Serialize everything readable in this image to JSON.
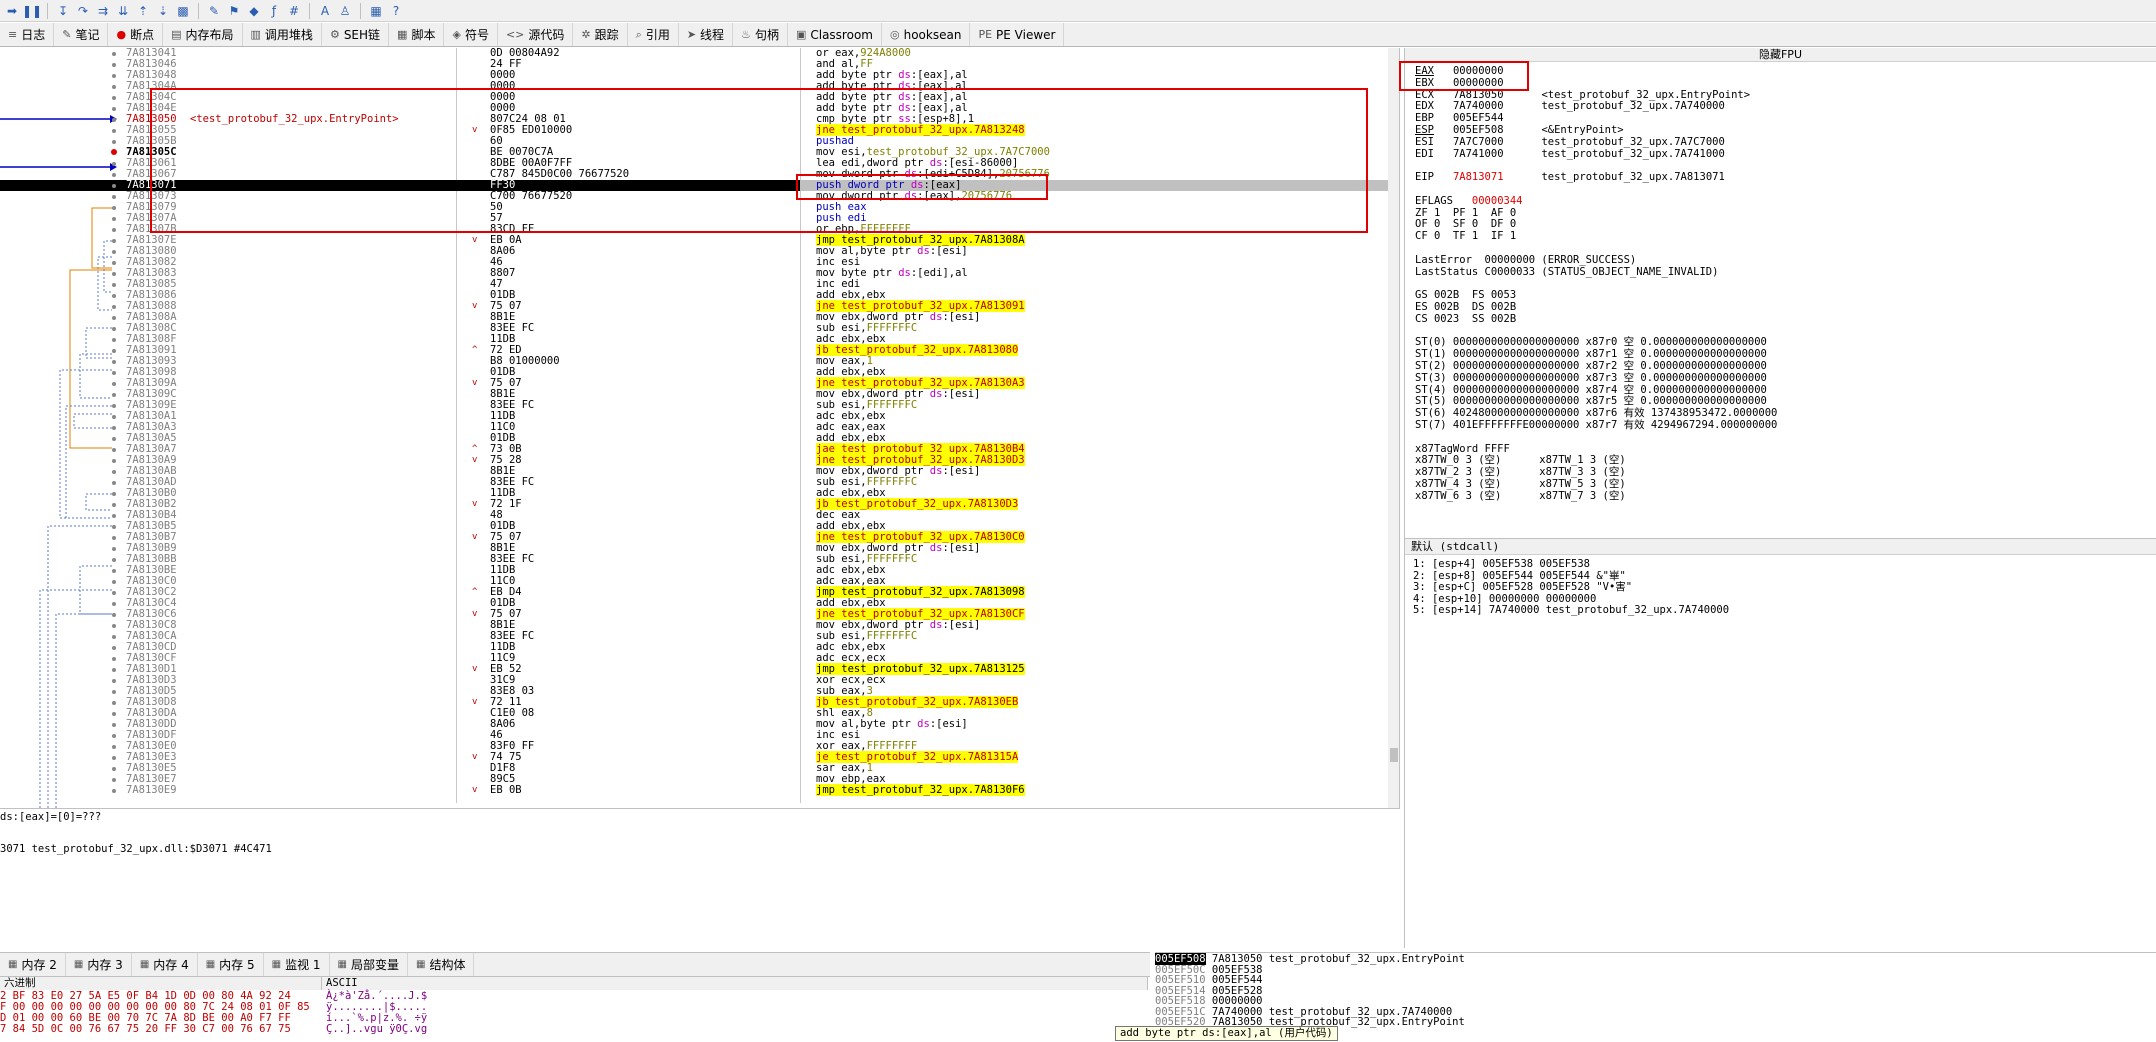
{
  "tabs": [
    {
      "icon": "log-icon",
      "glyph": "≡",
      "label": "日志"
    },
    {
      "icon": "notes-icon",
      "glyph": "✎",
      "label": "笔记"
    },
    {
      "icon": "breakpoint-icon",
      "glyph": "●",
      "label": "断点"
    },
    {
      "icon": "memory-map-icon",
      "glyph": "▤",
      "label": "内存布局"
    },
    {
      "icon": "callstack-icon",
      "glyph": "▥",
      "label": "调用堆栈"
    },
    {
      "icon": "seh-icon",
      "glyph": "⚙",
      "label": "SEH链"
    },
    {
      "icon": "script-icon",
      "glyph": "▦",
      "label": "脚本"
    },
    {
      "icon": "symbols-icon",
      "glyph": "◈",
      "label": "符号"
    },
    {
      "icon": "source-icon",
      "glyph": "<>",
      "label": "源代码"
    },
    {
      "icon": "trace-icon",
      "glyph": "✲",
      "label": "跟踪"
    },
    {
      "icon": "references-icon",
      "glyph": "⌕",
      "label": "引用"
    },
    {
      "icon": "threads-icon",
      "glyph": "➤",
      "label": "线程"
    },
    {
      "icon": "handles-icon",
      "glyph": "♨",
      "label": "句柄"
    },
    {
      "icon": "classroom-icon",
      "glyph": "▣",
      "label": "Classroom"
    },
    {
      "icon": "hooksean-icon",
      "glyph": "◎",
      "label": "hooksean"
    },
    {
      "icon": "pe-viewer-icon",
      "glyph": "PE",
      "label": "PE Viewer"
    }
  ],
  "disasm_rows": [
    {
      "addr": "7A813041",
      "bytes": "0D 00804A92",
      "jm": "",
      "ins": [
        [
          "op",
          "or eax,"
        ],
        [
          "num",
          "924A8000"
        ]
      ]
    },
    {
      "addr": "7A813046",
      "bytes": "24 FF",
      "jm": "",
      "ins": [
        [
          "op",
          "and al,"
        ],
        [
          "num",
          "FF"
        ]
      ]
    },
    {
      "addr": "7A813048",
      "bytes": "0000",
      "jm": "",
      "ins": [
        [
          "op",
          "add byte ptr "
        ],
        [
          "seg",
          "ds"
        ],
        [
          "op",
          ":[eax],al"
        ]
      ]
    },
    {
      "addr": "7A81304A",
      "bytes": "0000",
      "jm": "",
      "ins": [
        [
          "op",
          "add byte ptr "
        ],
        [
          "seg",
          "ds"
        ],
        [
          "op",
          ":[eax],al"
        ]
      ]
    },
    {
      "addr": "7A81304C",
      "bytes": "0000",
      "jm": "",
      "ins": [
        [
          "op",
          "add byte ptr "
        ],
        [
          "seg",
          "ds"
        ],
        [
          "op",
          ":[eax],al"
        ]
      ]
    },
    {
      "addr": "7A81304E",
      "bytes": "0000",
      "jm": "",
      "ins": [
        [
          "op",
          "add byte ptr "
        ],
        [
          "seg",
          "ds"
        ],
        [
          "op",
          ":[eax],al"
        ]
      ]
    },
    {
      "addr": "7A813050",
      "bytes": "807C24 08 01",
      "jm": "",
      "ep": "ep",
      "label": "<test_protobuf_32_upx.EntryPoint>",
      "ins": [
        [
          "op",
          "cmp byte ptr "
        ],
        [
          "seg",
          "ss"
        ],
        [
          "op",
          ":[esp+8],1"
        ]
      ]
    },
    {
      "addr": "7A813055",
      "bytes": "0F85 ED010000",
      "jm": "v",
      "ins": [
        [
          "jc",
          "jne test_protobuf_32_upx.7A813248"
        ]
      ]
    },
    {
      "addr": "7A81305B",
      "bytes": "60",
      "jm": "",
      "ins": [
        [
          "push",
          "pushad"
        ]
      ]
    },
    {
      "addr": "7A81305C",
      "bytes": "BE 0070C7A",
      "jm": "",
      "ep": "ep2",
      "ins": [
        [
          "op",
          "mov esi,"
        ],
        [
          "num",
          "test_protobuf_32_upx.7A7C7000"
        ]
      ]
    },
    {
      "addr": "7A813061",
      "bytes": "8DBE 00A0F7FF",
      "jm": "",
      "ins": [
        [
          "op",
          "lea edi,dword ptr "
        ],
        [
          "seg",
          "ds"
        ],
        [
          "op",
          ":[esi-86000]"
        ]
      ]
    },
    {
      "addr": "7A813067",
      "bytes": "C787 845D0C00 76677520",
      "jm": "",
      "ins": [
        [
          "op",
          "mov dword ptr "
        ],
        [
          "seg",
          "ds"
        ],
        [
          "op",
          ":[edi+C5D84],"
        ],
        [
          "num",
          "20756776"
        ]
      ]
    },
    {
      "addr": "7A813071",
      "bytes": "FF30",
      "jm": "",
      "sel": true,
      "ins": [
        [
          "push",
          "push dword ptr "
        ],
        [
          "seg",
          "ds"
        ],
        [
          "op",
          ":[eax]"
        ]
      ]
    },
    {
      "addr": "7A813073",
      "bytes": "C700 76677520",
      "jm": "",
      "ins": [
        [
          "op",
          "mov dword ptr "
        ],
        [
          "seg",
          "ds"
        ],
        [
          "op",
          ":[eax],"
        ],
        [
          "num",
          "20756776"
        ]
      ]
    },
    {
      "addr": "7A813079",
      "bytes": "50",
      "jm": "",
      "ins": [
        [
          "push",
          "push eax"
        ]
      ]
    },
    {
      "addr": "7A81307A",
      "bytes": "57",
      "jm": "",
      "ins": [
        [
          "push",
          "push edi"
        ]
      ]
    },
    {
      "addr": "7A81307B",
      "bytes": "83CD FF",
      "jm": "",
      "ins": [
        [
          "op",
          "or ebp,"
        ],
        [
          "num",
          "FFFFFFFF"
        ]
      ]
    },
    {
      "addr": "7A81307E",
      "bytes": "EB 0A",
      "jm": "v",
      "ins": [
        [
          "jmp",
          "jmp test_protobuf_32_upx.7A81308A"
        ]
      ]
    },
    {
      "addr": "7A813080",
      "bytes": "8A06",
      "jm": "",
      "ins": [
        [
          "op",
          "mov al,byte ptr "
        ],
        [
          "seg",
          "ds"
        ],
        [
          "op",
          ":[esi]"
        ]
      ]
    },
    {
      "addr": "7A813082",
      "bytes": "46",
      "jm": "",
      "ins": [
        [
          "op",
          "inc esi"
        ]
      ]
    },
    {
      "addr": "7A813083",
      "bytes": "8807",
      "jm": "",
      "ins": [
        [
          "op",
          "mov byte ptr "
        ],
        [
          "seg",
          "ds"
        ],
        [
          "op",
          ":[edi],al"
        ]
      ]
    },
    {
      "addr": "7A813085",
      "bytes": "47",
      "jm": "",
      "ins": [
        [
          "op",
          "inc edi"
        ]
      ]
    },
    {
      "addr": "7A813086",
      "bytes": "01DB",
      "jm": "",
      "ins": [
        [
          "op",
          "add ebx,ebx"
        ]
      ]
    },
    {
      "addr": "7A813088",
      "bytes": "75 07",
      "jm": "v",
      "ins": [
        [
          "jc",
          "jne test_protobuf_32_upx.7A813091"
        ]
      ]
    },
    {
      "addr": "7A81308A",
      "bytes": "8B1E",
      "jm": "",
      "ins": [
        [
          "op",
          "mov ebx,dword ptr "
        ],
        [
          "seg",
          "ds"
        ],
        [
          "op",
          ":[esi]"
        ]
      ]
    },
    {
      "addr": "7A81308C",
      "bytes": "83EE FC",
      "jm": "",
      "ins": [
        [
          "op",
          "sub esi,"
        ],
        [
          "num",
          "FFFFFFFC"
        ]
      ]
    },
    {
      "addr": "7A81308F",
      "bytes": "11DB",
      "jm": "",
      "ins": [
        [
          "op",
          "adc ebx,ebx"
        ]
      ]
    },
    {
      "addr": "7A813091",
      "bytes": "72 ED",
      "jm": "^",
      "ins": [
        [
          "jc",
          "jb test_protobuf_32_upx.7A813080"
        ]
      ]
    },
    {
      "addr": "7A813093",
      "bytes": "B8 01000000",
      "jm": "",
      "ins": [
        [
          "op",
          "mov eax,"
        ],
        [
          "num",
          "1"
        ]
      ]
    },
    {
      "addr": "7A813098",
      "bytes": "01DB",
      "jm": "",
      "ins": [
        [
          "op",
          "add ebx,ebx"
        ]
      ]
    },
    {
      "addr": "7A81309A",
      "bytes": "75 07",
      "jm": "v",
      "ins": [
        [
          "jc",
          "jne test_protobuf_32_upx.7A8130A3"
        ]
      ]
    },
    {
      "addr": "7A81309C",
      "bytes": "8B1E",
      "jm": "",
      "ins": [
        [
          "op",
          "mov ebx,dword ptr "
        ],
        [
          "seg",
          "ds"
        ],
        [
          "op",
          ":[esi]"
        ]
      ]
    },
    {
      "addr": "7A81309E",
      "bytes": "83EE FC",
      "jm": "",
      "ins": [
        [
          "op",
          "sub esi,"
        ],
        [
          "num",
          "FFFFFFFC"
        ]
      ]
    },
    {
      "addr": "7A8130A1",
      "bytes": "11DB",
      "jm": "",
      "ins": [
        [
          "op",
          "adc ebx,ebx"
        ]
      ]
    },
    {
      "addr": "7A8130A3",
      "bytes": "11C0",
      "jm": "",
      "ins": [
        [
          "op",
          "adc eax,eax"
        ]
      ]
    },
    {
      "addr": "7A8130A5",
      "bytes": "01DB",
      "jm": "",
      "ins": [
        [
          "op",
          "add ebx,ebx"
        ]
      ]
    },
    {
      "addr": "7A8130A7",
      "bytes": "73 0B",
      "jm": "^",
      "ins": [
        [
          "jc",
          "jae test_protobuf_32_upx.7A8130B4"
        ]
      ]
    },
    {
      "addr": "7A8130A9",
      "bytes": "75 28",
      "jm": "v",
      "ins": [
        [
          "jc",
          "jne test_protobuf_32_upx.7A8130D3"
        ]
      ]
    },
    {
      "addr": "7A8130AB",
      "bytes": "8B1E",
      "jm": "",
      "ins": [
        [
          "op",
          "mov ebx,dword ptr "
        ],
        [
          "seg",
          "ds"
        ],
        [
          "op",
          ":[esi]"
        ]
      ]
    },
    {
      "addr": "7A8130AD",
      "bytes": "83EE FC",
      "jm": "",
      "ins": [
        [
          "op",
          "sub esi,"
        ],
        [
          "num",
          "FFFFFFFC"
        ]
      ]
    },
    {
      "addr": "7A8130B0",
      "bytes": "11DB",
      "jm": "",
      "ins": [
        [
          "op",
          "adc ebx,ebx"
        ]
      ]
    },
    {
      "addr": "7A8130B2",
      "bytes": "72 1F",
      "jm": "v",
      "ins": [
        [
          "jc",
          "jb test_protobuf_32_upx.7A8130D3"
        ]
      ]
    },
    {
      "addr": "7A8130B4",
      "bytes": "48",
      "jm": "",
      "ins": [
        [
          "op",
          "dec eax"
        ]
      ]
    },
    {
      "addr": "7A8130B5",
      "bytes": "01DB",
      "jm": "",
      "ins": [
        [
          "op",
          "add ebx,ebx"
        ]
      ]
    },
    {
      "addr": "7A8130B7",
      "bytes": "75 07",
      "jm": "v",
      "ins": [
        [
          "jc",
          "jne test_protobuf_32_upx.7A8130C0"
        ]
      ]
    },
    {
      "addr": "7A8130B9",
      "bytes": "8B1E",
      "jm": "",
      "ins": [
        [
          "op",
          "mov ebx,dword ptr "
        ],
        [
          "seg",
          "ds"
        ],
        [
          "op",
          ":[esi]"
        ]
      ]
    },
    {
      "addr": "7A8130BB",
      "bytes": "83EE FC",
      "jm": "",
      "ins": [
        [
          "op",
          "sub esi,"
        ],
        [
          "num",
          "FFFFFFFC"
        ]
      ]
    },
    {
      "addr": "7A8130BE",
      "bytes": "11DB",
      "jm": "",
      "ins": [
        [
          "op",
          "adc ebx,ebx"
        ]
      ]
    },
    {
      "addr": "7A8130C0",
      "bytes": "11C0",
      "jm": "",
      "ins": [
        [
          "op",
          "adc eax,eax"
        ]
      ]
    },
    {
      "addr": "7A8130C2",
      "bytes": "EB D4",
      "jm": "^",
      "ins": [
        [
          "jmp",
          "jmp test_protobuf_32_upx.7A813098"
        ]
      ]
    },
    {
      "addr": "7A8130C4",
      "bytes": "01DB",
      "jm": "",
      "ins": [
        [
          "op",
          "add ebx,ebx"
        ]
      ]
    },
    {
      "addr": "7A8130C6",
      "bytes": "75 07",
      "jm": "v",
      "ins": [
        [
          "jc",
          "jne test_protobuf_32_upx.7A8130CF"
        ]
      ]
    },
    {
      "addr": "7A8130C8",
      "bytes": "8B1E",
      "jm": "",
      "ins": [
        [
          "op",
          "mov ebx,dword ptr "
        ],
        [
          "seg",
          "ds"
        ],
        [
          "op",
          ":[esi]"
        ]
      ]
    },
    {
      "addr": "7A8130CA",
      "bytes": "83EE FC",
      "jm": "",
      "ins": [
        [
          "op",
          "sub esi,"
        ],
        [
          "num",
          "FFFFFFFC"
        ]
      ]
    },
    {
      "addr": "7A8130CD",
      "bytes": "11DB",
      "jm": "",
      "ins": [
        [
          "op",
          "adc ebx,ebx"
        ]
      ]
    },
    {
      "addr": "7A8130CF",
      "bytes": "11C9",
      "jm": "",
      "ins": [
        [
          "op",
          "adc ecx,ecx"
        ]
      ]
    },
    {
      "addr": "7A8130D1",
      "bytes": "EB 52",
      "jm": "v",
      "ins": [
        [
          "jmp",
          "jmp test_protobuf_32_upx.7A813125"
        ]
      ]
    },
    {
      "addr": "7A8130D3",
      "bytes": "31C9",
      "jm": "",
      "ins": [
        [
          "op",
          "xor ecx,ecx"
        ]
      ]
    },
    {
      "addr": "7A8130D5",
      "bytes": "83E8 03",
      "jm": "",
      "ins": [
        [
          "op",
          "sub eax,"
        ],
        [
          "num",
          "3"
        ]
      ]
    },
    {
      "addr": "7A8130D8",
      "bytes": "72 11",
      "jm": "v",
      "ins": [
        [
          "jc",
          "jb test_protobuf_32_upx.7A8130EB"
        ]
      ]
    },
    {
      "addr": "7A8130DA",
      "bytes": "C1E0 08",
      "jm": "",
      "ins": [
        [
          "op",
          "shl eax,"
        ],
        [
          "num",
          "8"
        ]
      ]
    },
    {
      "addr": "7A8130DD",
      "bytes": "8A06",
      "jm": "",
      "ins": [
        [
          "op",
          "mov al,byte ptr "
        ],
        [
          "seg",
          "ds"
        ],
        [
          "op",
          ":[esi]"
        ]
      ]
    },
    {
      "addr": "7A8130DF",
      "bytes": "46",
      "jm": "",
      "ins": [
        [
          "op",
          "inc esi"
        ]
      ]
    },
    {
      "addr": "7A8130E0",
      "bytes": "83F0 FF",
      "jm": "",
      "ins": [
        [
          "op",
          "xor eax,"
        ],
        [
          "num",
          "FFFFFFFF"
        ]
      ]
    },
    {
      "addr": "7A8130E3",
      "bytes": "74 75",
      "jm": "v",
      "ins": [
        [
          "jc",
          "je test_protobuf_32_upx.7A81315A"
        ]
      ]
    },
    {
      "addr": "7A8130E5",
      "bytes": "D1F8",
      "jm": "",
      "ins": [
        [
          "op",
          "sar eax,"
        ],
        [
          "num",
          "1"
        ]
      ]
    },
    {
      "addr": "7A8130E7",
      "bytes": "89C5",
      "jm": "",
      "ins": [
        [
          "op",
          "mov ebp,eax"
        ]
      ]
    },
    {
      "addr": "7A8130E9",
      "bytes": "EB 0B",
      "jm": "v",
      "ins": [
        [
          "jmp",
          "jmp test_protobuf_32_upx.7A8130F6"
        ]
      ]
    }
  ],
  "info": {
    "line1": "ds:[eax]=[0]=???",
    "line2": "3071 test_protobuf_32_upx.dll:$D3071 #4C471"
  },
  "registers": {
    "header": "隐藏FPU",
    "lines": [
      [
        "EAX",
        "00000000",
        ""
      ],
      [
        "EBX",
        "00000000",
        ""
      ],
      [
        "ECX",
        "7A813050",
        "<test_protobuf_32_upx.EntryPoint>"
      ],
      [
        "EDX",
        "7A740000",
        "test_protobuf_32_upx.7A740000"
      ],
      [
        "EBP",
        "005EF544",
        ""
      ],
      [
        "ESP",
        "005EF508",
        "<&EntryPoint>"
      ],
      [
        "ESI",
        "7A7C7000",
        "test_protobuf_32_upx.7A7C7000"
      ],
      [
        "EDI",
        "7A741000",
        "test_protobuf_32_upx.7A741000"
      ]
    ],
    "eip": [
      "EIP",
      "7A813071",
      "test_protobuf_32_upx.7A813071"
    ],
    "eflags": [
      "EFLAGS",
      "00000344"
    ],
    "flags": [
      "ZF 1  PF 1  AF 0",
      "OF 0  SF 0  DF 0",
      "CF 0  TF 1  IF 1"
    ],
    "lasterror": "LastError  00000000 (ERROR_SUCCESS)",
    "laststatus": "LastStatus C0000033 (STATUS_OBJECT_NAME_INVALID)",
    "segs": [
      "GS 002B  FS 0053",
      "ES 002B  DS 002B",
      "CS 0023  SS 002B"
    ],
    "fpu": [
      "ST(0) 00000000000000000000 x87r0 空 0.000000000000000000",
      "ST(1) 00000000000000000000 x87r1 空 0.000000000000000000",
      "ST(2) 00000000000000000000 x87r2 空 0.000000000000000000",
      "ST(3) 00000000000000000000 x87r3 空 0.000000000000000000",
      "ST(4) 00000000000000000000 x87r4 空 0.000000000000000000",
      "ST(5) 00000000000000000000 x87r5 空 0.000000000000000000",
      "ST(6) 40248000000000000000 x87r6 有效 137438953472.0000000",
      "ST(7) 401EFFFFFFFE00000000 x87r7 有效 4294967294.000000000"
    ],
    "tagword": "x87TagWord FFFF",
    "tags": [
      "x87TW_0 3 (空)      x87TW_1 3 (空)",
      "x87TW_2 3 (空)      x87TW_3 3 (空)",
      "x87TW_4 3 (空)      x87TW_5 3 (空)",
      "x87TW_6 3 (空)      x87TW_7 3 (空)"
    ]
  },
  "callstack": {
    "header": "默认 (stdcall)",
    "items": [
      "1: [esp+4] 005EF538 005EF538",
      "2: [esp+8] 005EF544 005EF544 &\"崋\"",
      "3: [esp+C] 005EF528 005EF528 \"V•害\"",
      "4: [esp+10] 00000000 00000000",
      "5: [esp+14] 7A740000 test_protobuf_32_upx.7A740000"
    ]
  },
  "bottom_tabs": [
    {
      "icon": "memory-icon",
      "label": "内存 2"
    },
    {
      "icon": "memory-icon",
      "label": "内存 3"
    },
    {
      "icon": "memory-icon",
      "label": "内存 4"
    },
    {
      "icon": "memory-icon",
      "label": "内存 5"
    },
    {
      "icon": "watch-icon",
      "label": "监视 1"
    },
    {
      "icon": "locals-icon",
      "label": "局部变量"
    },
    {
      "icon": "struct-icon",
      "label": "结构体"
    }
  ],
  "hexdump": {
    "hex_header": "六进制",
    "ascii_header": "ASCII",
    "rows": [
      {
        "hex": "2 BF 83 E0 27 5A E5 0F B4 1D 0D 00 80 4A 92 24",
        "ascii": "À¿*à'Zå.´....J.$"
      },
      {
        "hex": "F 00 00 00 00 00 00 00 00 00 80 7C 24 08 01 0F 85",
        "ascii": "ÿ........|$....."
      },
      {
        "hex": "D 01 00 00 60 BE 00 70 7C 7A 8D BE 00 A0 F7 FF",
        "ascii": "í...`%.p|z.%. ÷ÿ"
      },
      {
        "hex": "7 84 5D 0C 00 76 67 75 20 FF 30 C7 00 76 67 75",
        "ascii": "Ç..]..vgu ÿ0Ç.vg"
      }
    ]
  },
  "stackdump": {
    "rows": [
      {
        "a": "005EF508",
        "v": "7A813050",
        "c": "test_protobuf_32_upx.EntryPoint",
        "sel": true
      },
      {
        "a": "005EF50C",
        "v": "005EF538",
        "c": ""
      },
      {
        "a": "005EF510",
        "v": "005EF544",
        "c": ""
      },
      {
        "a": "005EF514",
        "v": "005EF528",
        "c": ""
      },
      {
        "a": "005EF518",
        "v": "00000000",
        "c": ""
      },
      {
        "a": "005EF51C",
        "v": "7A740000",
        "c": "test_protobuf_32_upx.7A740000"
      },
      {
        "a": "005EF520",
        "v": "7A813050",
        "c": "test_protobuf_32_upx.EntryPoint"
      }
    ],
    "tooltip": "add byte ptr ds:[eax],al (用户代码)"
  }
}
